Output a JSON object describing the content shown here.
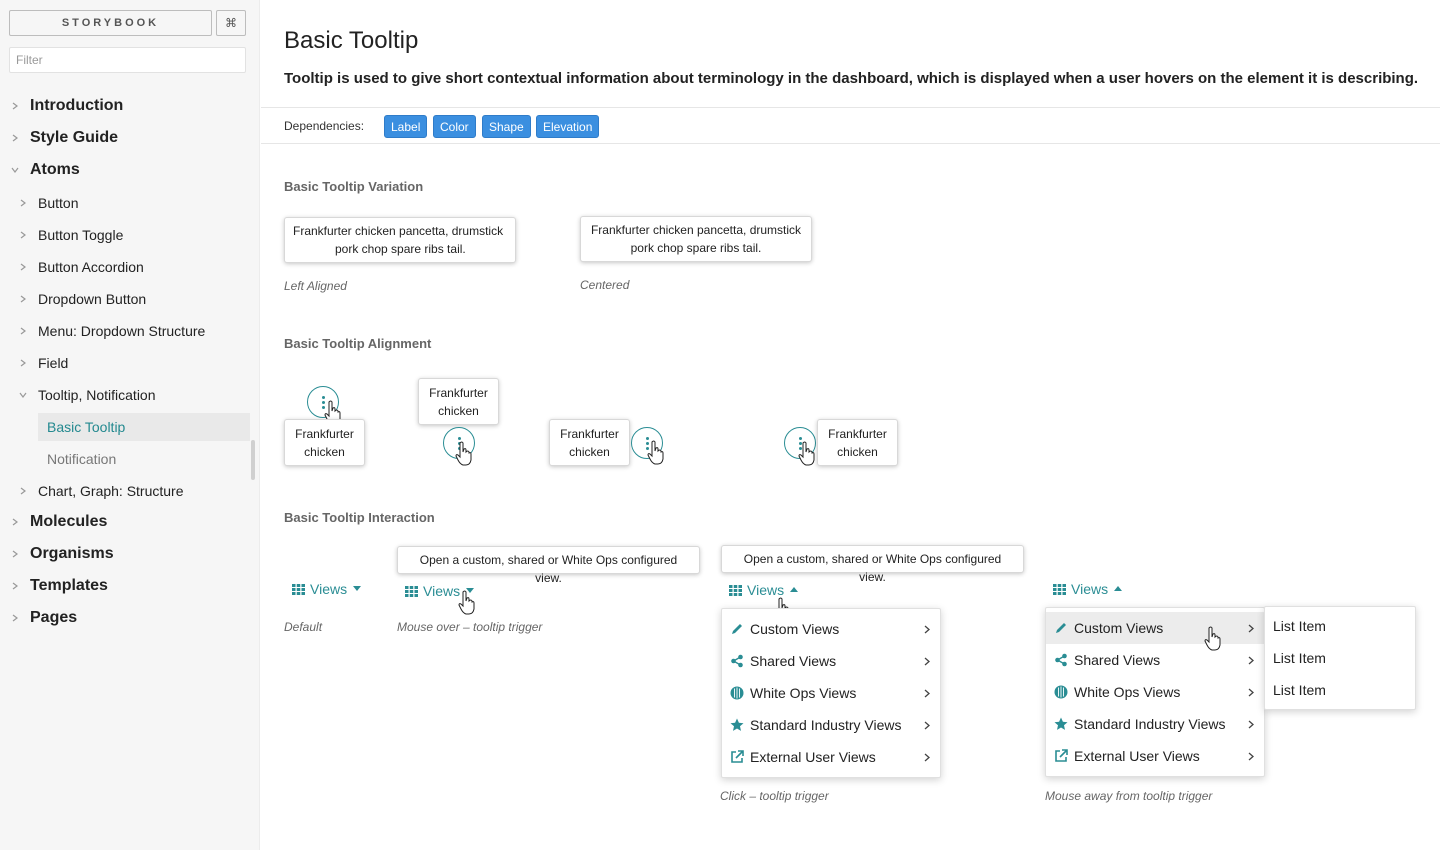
{
  "sidebar": {
    "brand": "STORYBOOK",
    "shortcut": "⌘",
    "filter_placeholder": "Filter",
    "items": [
      {
        "label": "Introduction"
      },
      {
        "label": "Style Guide"
      },
      {
        "label": "Atoms"
      },
      {
        "label": "Button"
      },
      {
        "label": "Button Toggle"
      },
      {
        "label": "Button Accordion"
      },
      {
        "label": "Dropdown Button"
      },
      {
        "label": "Menu: Dropdown Structure"
      },
      {
        "label": "Field"
      },
      {
        "label": "Tooltip, Notification"
      },
      {
        "label": "Basic Tooltip"
      },
      {
        "label": "Notification"
      },
      {
        "label": "Chart, Graph: Structure"
      },
      {
        "label": "Molecules"
      },
      {
        "label": "Organisms"
      },
      {
        "label": "Templates"
      },
      {
        "label": "Pages"
      }
    ]
  },
  "page": {
    "title": "Basic Tooltip",
    "description": "Tooltip is used to give short contextual information about terminology in the dashboard, which is displayed when a user hovers on the element it is describing.",
    "dependencies_label": "Dependencies:",
    "dependencies": [
      "Label",
      "Color",
      "Shape",
      "Elevation"
    ]
  },
  "variation": {
    "title": "Basic Tooltip Variation",
    "tooltip_line1": "Frankfurter chicken pancetta, drumstick",
    "tooltip_line2": "pork chop spare ribs tail.",
    "caption_left": "Left Aligned",
    "caption_center": "Centered"
  },
  "alignment": {
    "title": "Basic Tooltip Alignment",
    "tooltip_line1": "Frankfurter",
    "tooltip_line2": "chicken"
  },
  "interaction": {
    "title": "Basic Tooltip Interaction",
    "views_label": "Views",
    "tooltip_text": "Open a custom, shared or White Ops configured view.",
    "caption_default": "Default",
    "caption_mouseover": "Mouse over – tooltip trigger",
    "caption_click": "Click – tooltip trigger",
    "caption_mouseaway": "Mouse away from tooltip trigger",
    "menu": [
      {
        "label": "Custom Views",
        "icon": "pencil-icon"
      },
      {
        "label": "Shared Views",
        "icon": "share-icon"
      },
      {
        "label": "White Ops Views",
        "icon": "whiteops-logo-icon"
      },
      {
        "label": "Standard Industry Views",
        "icon": "star-icon"
      },
      {
        "label": "External User Views",
        "icon": "external-link-icon"
      }
    ],
    "submenu": [
      "List Item",
      "List Item",
      "List Item"
    ]
  },
  "colors": {
    "accent": "#2a8d94",
    "chip": "#3b8fe0",
    "active_nav": "#23898f"
  }
}
